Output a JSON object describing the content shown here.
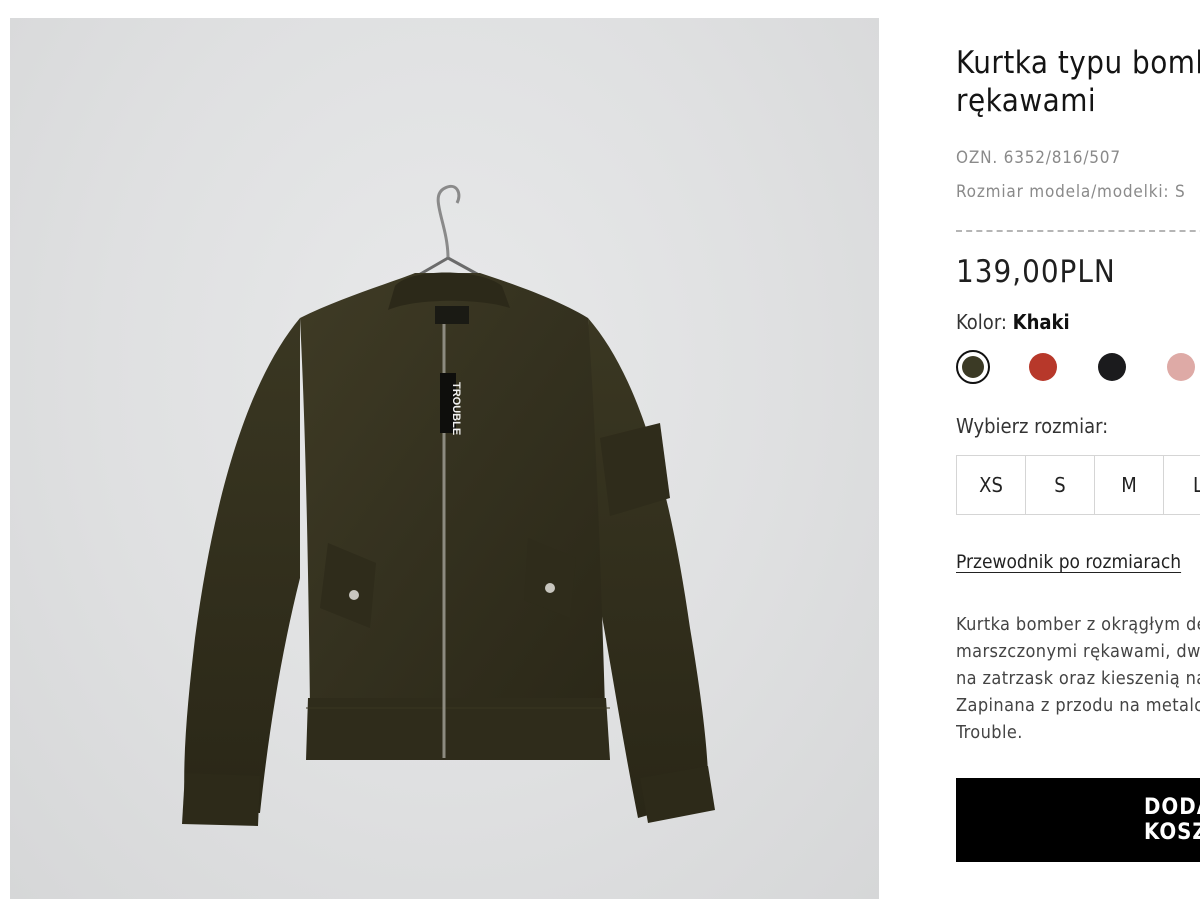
{
  "product": {
    "title": "Kurtka typu bomber z marszczonymi\nrękawami",
    "reference": "OZN. 6352/816/507",
    "model_size": "Rozmiar modela/modelki: S",
    "price": "139,00PLN",
    "color_label": "Kolor:",
    "color_value": "Khaki",
    "colors": [
      {
        "name": "Khaki",
        "hex": "#3b3a25",
        "selected": true
      },
      {
        "name": "Czerwony",
        "hex": "#b7382a",
        "selected": false
      },
      {
        "name": "Czarny",
        "hex": "#1b1b1d",
        "selected": false
      },
      {
        "name": "Różowy",
        "hex": "#deaaa6",
        "selected": false
      }
    ],
    "size_label": "Wybierz rozmiar:",
    "sizes": [
      "XS",
      "S",
      "M",
      "L"
    ],
    "size_guide": "Przewodnik po rozmiarach",
    "description_lines": [
      "Kurtka bomber z okrągłym dekoltem, długimi",
      "marszczonymi rękawami, dwiema kieszeniami",
      "na zatrzask oraz kieszenią na rękawie.",
      "Zapinana z przodu na metalowy zamek z napisem",
      "Trouble."
    ],
    "add_button": "DODAJ DO KOSZYKA"
  },
  "image": {
    "tag_text": "TROUBLE",
    "icon": "bomber-jacket-photo"
  }
}
